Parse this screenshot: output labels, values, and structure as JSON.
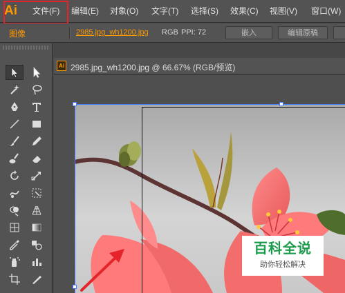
{
  "app": {
    "logo_text": "Ai"
  },
  "menu": {
    "items": [
      {
        "label": "文件(F)"
      },
      {
        "label": "编辑(E)"
      },
      {
        "label": "对象(O)"
      },
      {
        "label": "文字(T)"
      },
      {
        "label": "选择(S)"
      },
      {
        "label": "效果(C)"
      },
      {
        "label": "视图(V)"
      },
      {
        "label": "窗口(W)"
      }
    ]
  },
  "control_bar": {
    "mode_label": "图像",
    "file_link": "2985.jpg_wh1200.jpg",
    "color_mode": "RGB",
    "ppi": "PPI: 72",
    "embed_button": "嵌入",
    "edit_original_button": "编辑原稿"
  },
  "document": {
    "tab_title": "2985.jpg_wh1200.jpg @ 66.67% (RGB/预览)",
    "icon_text": "Ai"
  },
  "watermark": {
    "title": "百科全说",
    "subtitle": "助你轻松解决"
  },
  "colors": {
    "accent": "#ff9a00",
    "highlight": "#e4232a",
    "brand": "#1a9b4a"
  },
  "tools": [
    "selection-icon",
    "direct-selection-icon",
    "magic-wand-icon",
    "lasso-icon",
    "pen-icon",
    "type-icon",
    "line-segment-icon",
    "rectangle-icon",
    "paintbrush-icon",
    "pencil-icon",
    "blob-brush-icon",
    "eraser-icon",
    "rotate-icon",
    "scale-icon",
    "warp-icon",
    "free-transform-icon",
    "shape-builder-icon",
    "perspective-grid-icon",
    "mesh-icon",
    "gradient-icon",
    "eyedropper-icon",
    "blend-icon",
    "symbol-sprayer-icon",
    "column-graph-icon",
    "artboard-icon",
    "slice-icon"
  ]
}
